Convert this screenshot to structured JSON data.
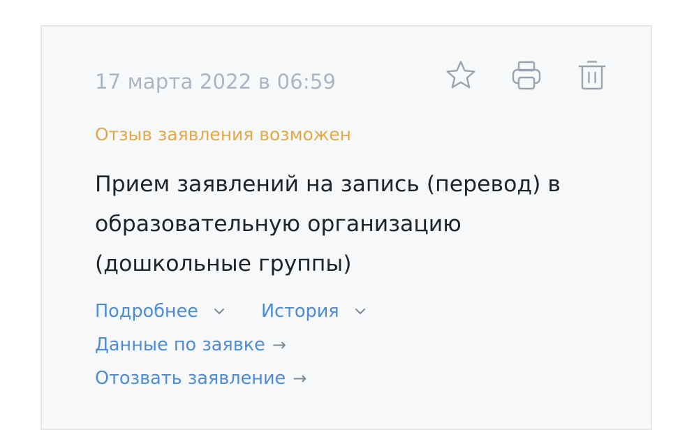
{
  "card": {
    "date": "17 марта 2022 в 06:59",
    "status": "Отзыв заявления возможен",
    "title": "Прием заявлений на запись (перевод) в образовательную организацию (дошкольные группы)",
    "actions": {
      "details_label": "Подробнее",
      "history_label": "История",
      "application_data_label": "Данные по заявке",
      "withdraw_label": "Отозвать заявление",
      "arrow": "→"
    },
    "icons": [
      "star-icon",
      "printer-icon",
      "trash-icon"
    ]
  },
  "colors": {
    "date": "#aab5c6",
    "status": "#e4a84b",
    "title": "#1f2429",
    "link": "#4f8cd6",
    "icon": "#9aa4b0",
    "card_bg": "#f7f8f9",
    "card_border": "#e4e7ea"
  }
}
